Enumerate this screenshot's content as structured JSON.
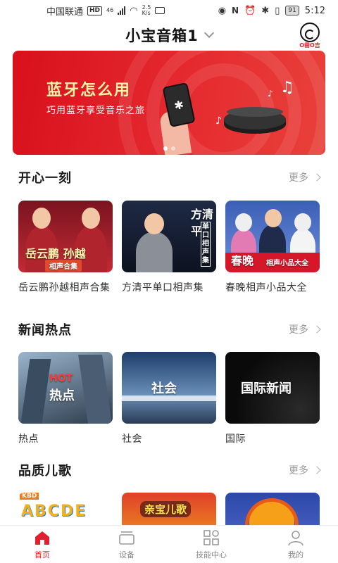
{
  "status_bar": {
    "carrier": "中国联通",
    "hd": "HD",
    "net_type": "46",
    "net_speed": "2.5",
    "net_speed_unit": "K/s",
    "battery": "91",
    "time": "5:12"
  },
  "header": {
    "device_name": "小宝音箱1",
    "brand_text": "O凿O吉"
  },
  "banner": {
    "title": "蓝牙怎么用",
    "subtitle": "巧用蓝牙享受音乐之旅",
    "slide_count": 2,
    "active_slide": 1
  },
  "sections": [
    {
      "title": "开心一刻",
      "more": "更多",
      "items": [
        {
          "label": "岳云鹏孙越相声合集",
          "thumb_text": "岳云鹏 孙越",
          "thumb_tag": "相声合集"
        },
        {
          "label": "方清平单口相声集",
          "thumb_text": "方清平",
          "thumb_tag": "单口相声集"
        },
        {
          "label": "春晚相声小品大全",
          "thumb_text": "春晚",
          "thumb_tag": "相声小品大全"
        }
      ]
    },
    {
      "title": "新闻热点",
      "more": "更多",
      "items": [
        {
          "label": "热点",
          "thumb_text": "热点",
          "thumb_tag": "HOT"
        },
        {
          "label": "社会",
          "thumb_text": "社会"
        },
        {
          "label": "国际",
          "thumb_text": "国际新闻"
        }
      ]
    },
    {
      "title": "品质儿歌",
      "more": "更多",
      "items": [
        {
          "thumb_text": "ABCDE",
          "thumb_tag": "KBD"
        },
        {
          "thumb_text": "亲宝儿歌"
        },
        {}
      ]
    }
  ],
  "bottom_nav": [
    {
      "label": "首页",
      "icon": "home-icon",
      "active": true
    },
    {
      "label": "设备",
      "icon": "device-icon",
      "active": false
    },
    {
      "label": "技能中心",
      "icon": "skills-icon",
      "active": false
    },
    {
      "label": "我的",
      "icon": "profile-icon",
      "active": false
    }
  ],
  "colors": {
    "accent": "#e0202e",
    "banner_red": "#d8101c",
    "title_yellow": "#fff3a8"
  }
}
